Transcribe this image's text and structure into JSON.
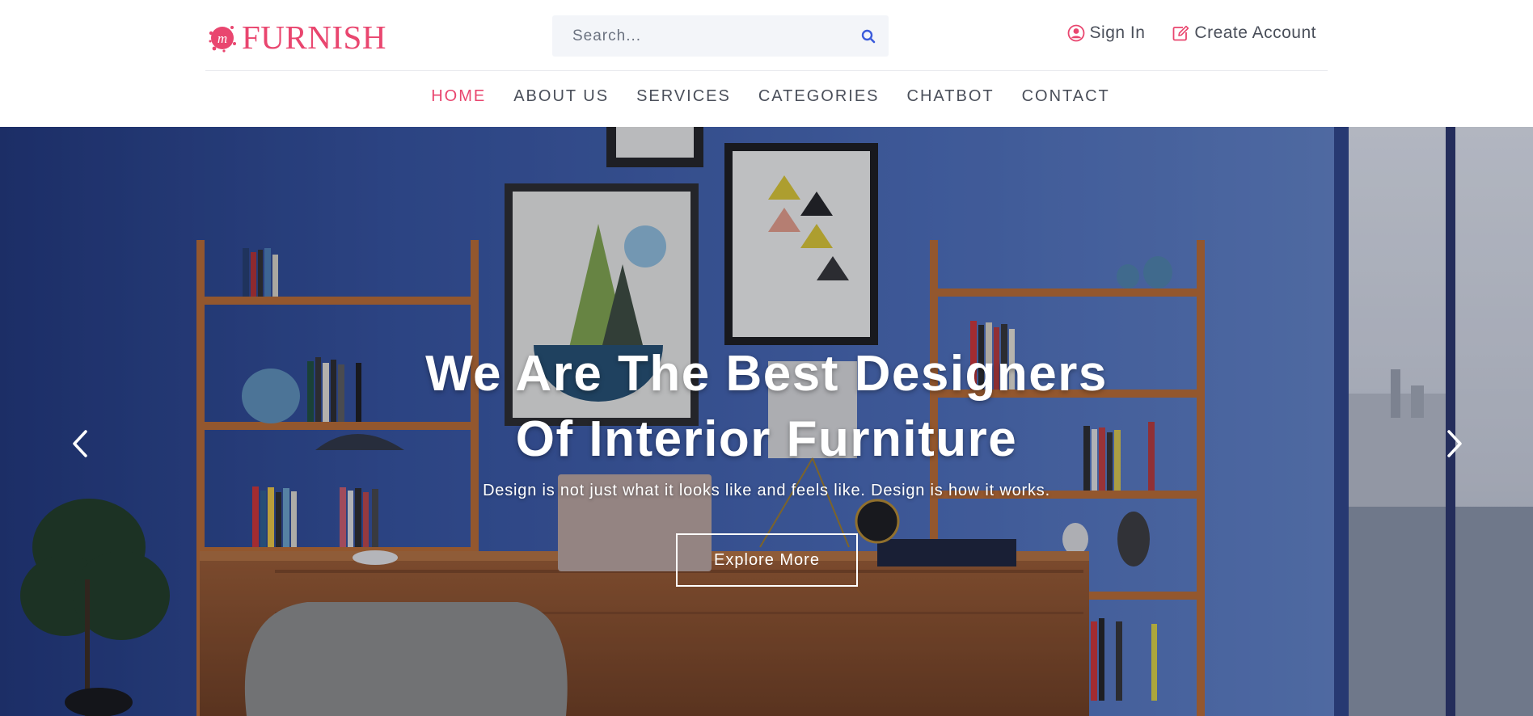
{
  "brand": {
    "name": "FURNISH",
    "mark_letter": "m",
    "accent": "#e9466f"
  },
  "search": {
    "placeholder": "Search..."
  },
  "auth": {
    "sign_in": "Sign In",
    "create_account": "Create Account"
  },
  "nav": {
    "items": [
      {
        "label": "HOME",
        "active": true
      },
      {
        "label": "ABOUT US",
        "active": false
      },
      {
        "label": "SERVICES",
        "active": false
      },
      {
        "label": "CATEGORIES",
        "active": false
      },
      {
        "label": "CHATBOT",
        "active": false
      },
      {
        "label": "CONTACT",
        "active": false
      }
    ]
  },
  "hero": {
    "title_line1": "We Are The Best Designers",
    "title_line2": "Of Interior Furniture",
    "subtitle": "Design is not just what it looks like and feels like. Design is how it works.",
    "button": "Explore More"
  },
  "icons": {
    "search": "search-icon",
    "user": "user-circle-icon",
    "edit": "edit-icon",
    "prev": "chevron-left-icon",
    "next": "chevron-right-icon"
  },
  "colors": {
    "accent": "#e9466f",
    "search_icon": "#3b5bdb",
    "nav_text": "#4a4f5a",
    "wall": "#4a6bb5"
  }
}
